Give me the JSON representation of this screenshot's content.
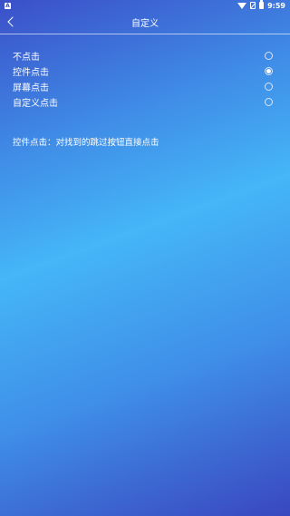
{
  "status_bar": {
    "notification_icon": "android-notification-icon",
    "notification_glyph": "A",
    "time": "9:59",
    "icons": [
      "wifi-icon",
      "no-sim-icon",
      "battery-icon"
    ]
  },
  "header": {
    "back_icon": "chevron-left-icon",
    "title": "自定义"
  },
  "options": [
    {
      "label": "不点击",
      "selected": false
    },
    {
      "label": "控件点击",
      "selected": true
    },
    {
      "label": "屏幕点击",
      "selected": false
    },
    {
      "label": "自定义点击",
      "selected": false
    }
  ],
  "description": "控件点击：对找到的跳过按钮直接点击",
  "colors": {
    "gradient_start": "#3b4fc8",
    "gradient_mid": "#45b6f7",
    "text": "#ffffff"
  }
}
